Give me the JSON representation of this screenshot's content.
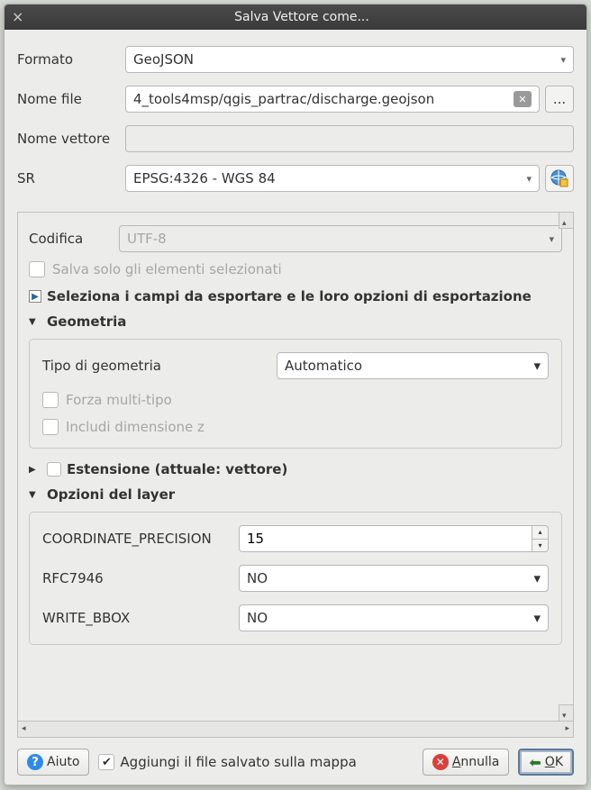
{
  "titlebar": {
    "title": "Salva Vettore come..."
  },
  "form": {
    "format_label": "Formato",
    "format_value": "GeoJSON",
    "filename_label": "Nome file",
    "filename_value": "4_tools4msp/qgis_partrac/discharge.geojson",
    "layername_label": "Nome vettore",
    "layername_value": "",
    "crs_label": "SR",
    "crs_value": "EPSG:4326 - WGS 84",
    "browse_label": "..."
  },
  "encoding": {
    "label": "Codifica",
    "value": "UTF-8",
    "save_selected_label": "Salva solo gli elementi selezionati"
  },
  "fields_section": "Seleziona i campi da esportare e le loro opzioni di esportazione",
  "geometry": {
    "title": "Geometria",
    "type_label": "Tipo di geometria",
    "type_value": "Automatico",
    "force_multi": "Forza multi-tipo",
    "include_z": "Includi dimensione z"
  },
  "extent": {
    "title": "Estensione (attuale: vettore)"
  },
  "layer_options": {
    "title": "Opzioni del layer",
    "coord_precision_label": "COORDINATE_PRECISION",
    "coord_precision_value": "15",
    "rfc7946_label": "RFC7946",
    "rfc7946_value": "NO",
    "write_bbox_label": "WRITE_BBOX",
    "write_bbox_value": "NO"
  },
  "footer": {
    "help": "Aiuto",
    "add_to_map": "Aggiungi il file salvato sulla mappa",
    "cancel_mn": "A",
    "cancel_rest": "nnulla",
    "ok_mn": "O",
    "ok_rest": "K"
  }
}
